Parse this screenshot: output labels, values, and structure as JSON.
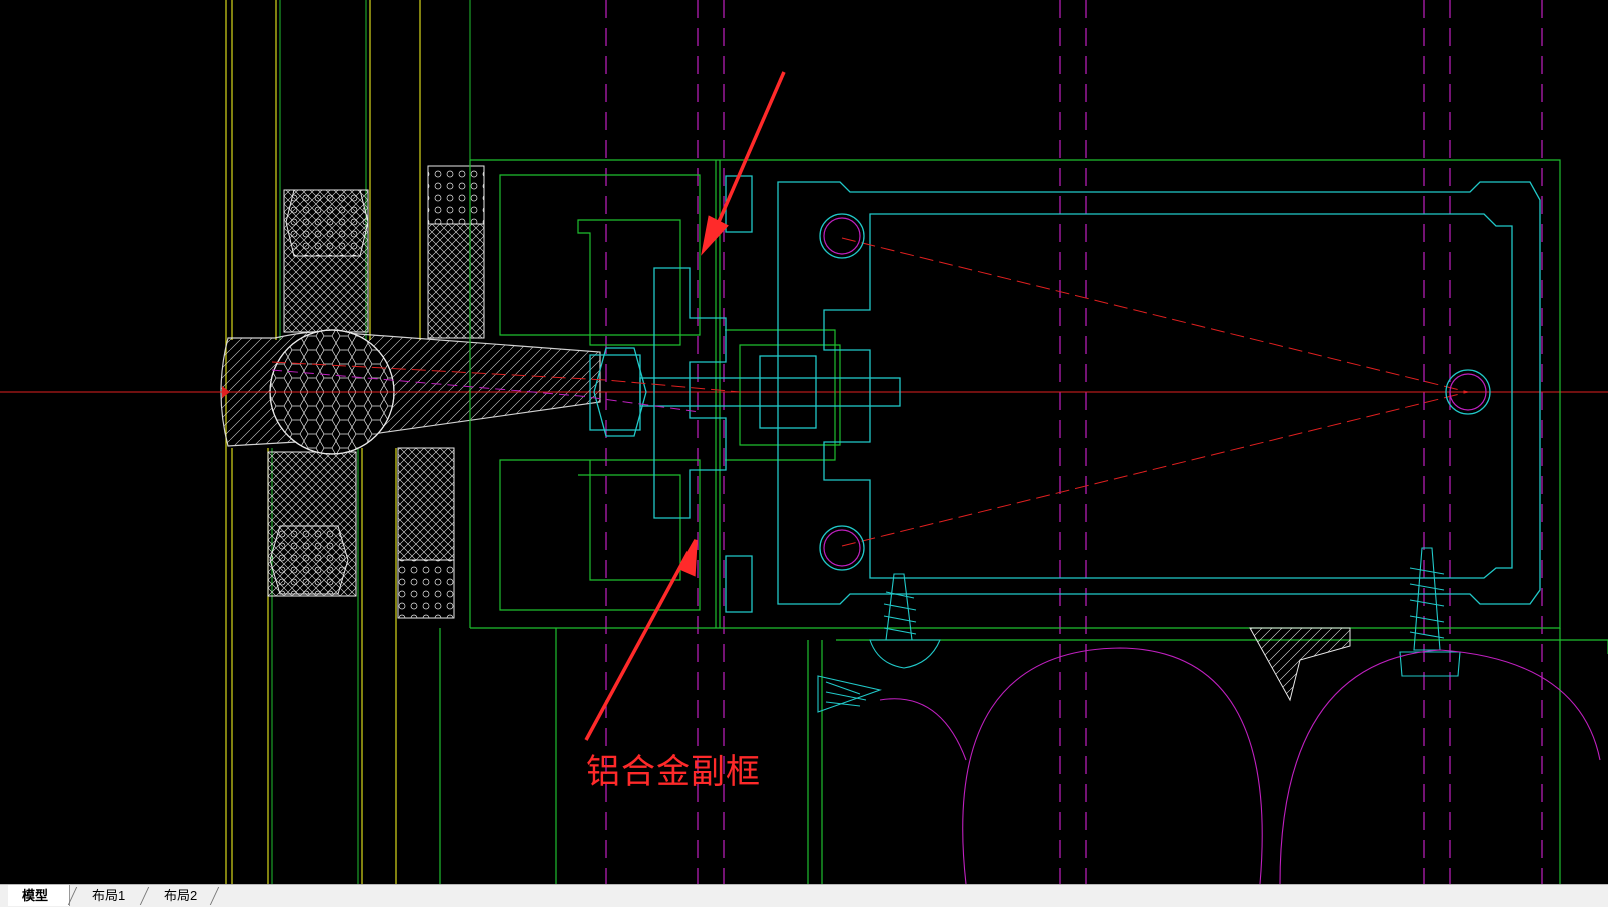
{
  "annotation": {
    "label": "铝合金副框",
    "color": "#ff2a2a"
  },
  "layout_tabs": [
    {
      "label": "模型",
      "active": true
    },
    {
      "label": "布局1",
      "active": false
    },
    {
      "label": "布局2",
      "active": false
    }
  ],
  "colors": {
    "background": "#000000",
    "frame_green": "#1fbf2f",
    "profile_cyan": "#21c9c9",
    "glass_yellow": "#d8d81c",
    "gridline_magenta": "#c020c0",
    "axis_red": "#e02020",
    "gasket_white": "#e8e8e8"
  }
}
